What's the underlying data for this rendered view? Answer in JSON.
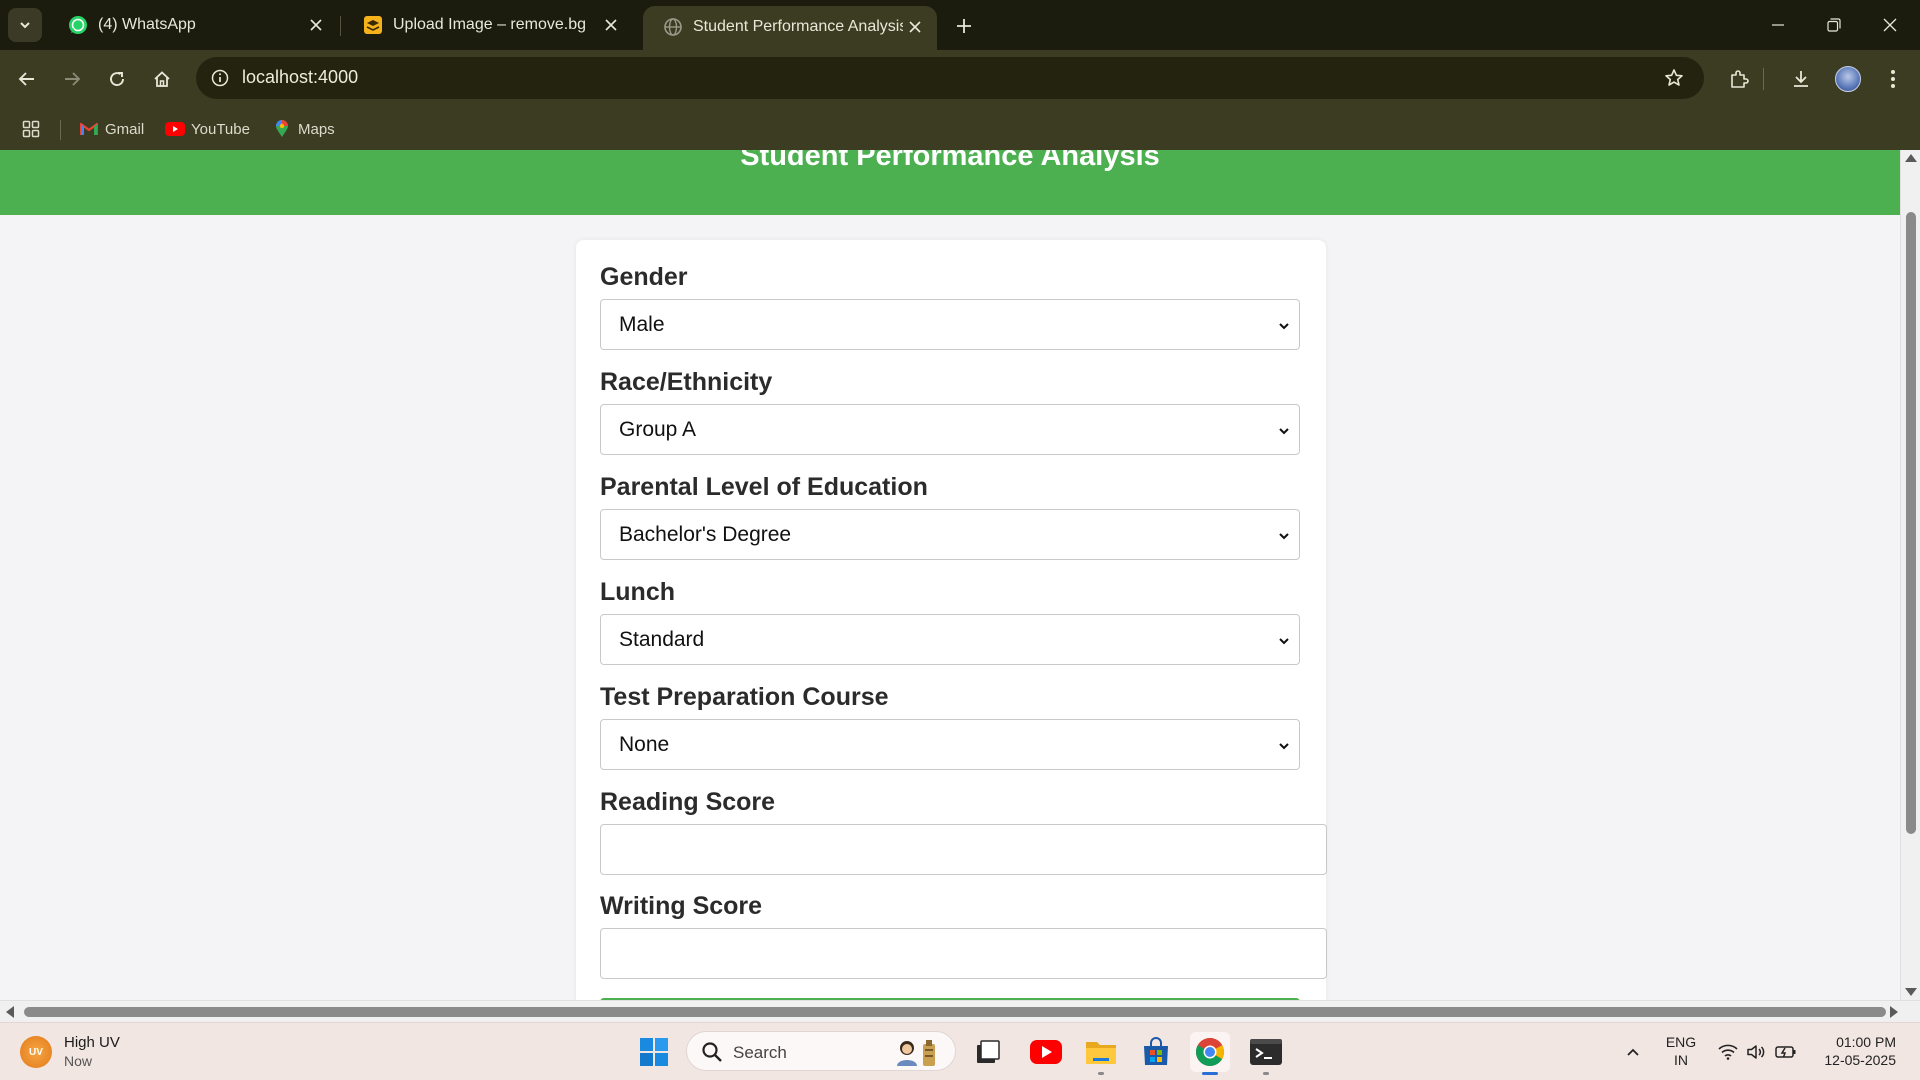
{
  "browser": {
    "tabs": [
      {
        "title": "(4) WhatsApp",
        "icon": "whatsapp-icon",
        "active": false
      },
      {
        "title": "Upload Image – remove.bg",
        "icon": "removebg-icon",
        "active": false
      },
      {
        "title": "Student Performance Analysis",
        "icon": "globe-icon",
        "active": true
      }
    ],
    "url": "localhost:4000",
    "bookmarks": [
      {
        "label": "Gmail",
        "icon": "gmail-icon"
      },
      {
        "label": "YouTube",
        "icon": "youtube-icon"
      },
      {
        "label": "Maps",
        "icon": "maps-icon"
      }
    ]
  },
  "page": {
    "title": "Student Performance Analysis",
    "header_color": "#4caf50",
    "fields": {
      "gender": {
        "label": "Gender",
        "value": "Male"
      },
      "race": {
        "label": "Race/Ethnicity",
        "value": "Group A"
      },
      "parental_education": {
        "label": "Parental Level of Education",
        "value": "Bachelor's Degree"
      },
      "lunch": {
        "label": "Lunch",
        "value": "Standard"
      },
      "test_prep": {
        "label": "Test Preparation Course",
        "value": "None"
      },
      "reading_score": {
        "label": "Reading Score",
        "value": ""
      },
      "writing_score": {
        "label": "Writing Score",
        "value": ""
      }
    }
  },
  "taskbar": {
    "weather": {
      "badge": "UV",
      "title": "High UV",
      "subtitle": "Now"
    },
    "search_placeholder": "Search",
    "apps": [
      "windows-start-icon",
      "task-view-icon",
      "youtube-app-icon",
      "file-explorer-icon",
      "microsoft-store-icon",
      "chrome-icon",
      "terminal-icon"
    ],
    "language": {
      "line1": "ENG",
      "line2": "IN"
    },
    "clock": {
      "time": "01:00 PM",
      "date": "12-05-2025"
    }
  }
}
